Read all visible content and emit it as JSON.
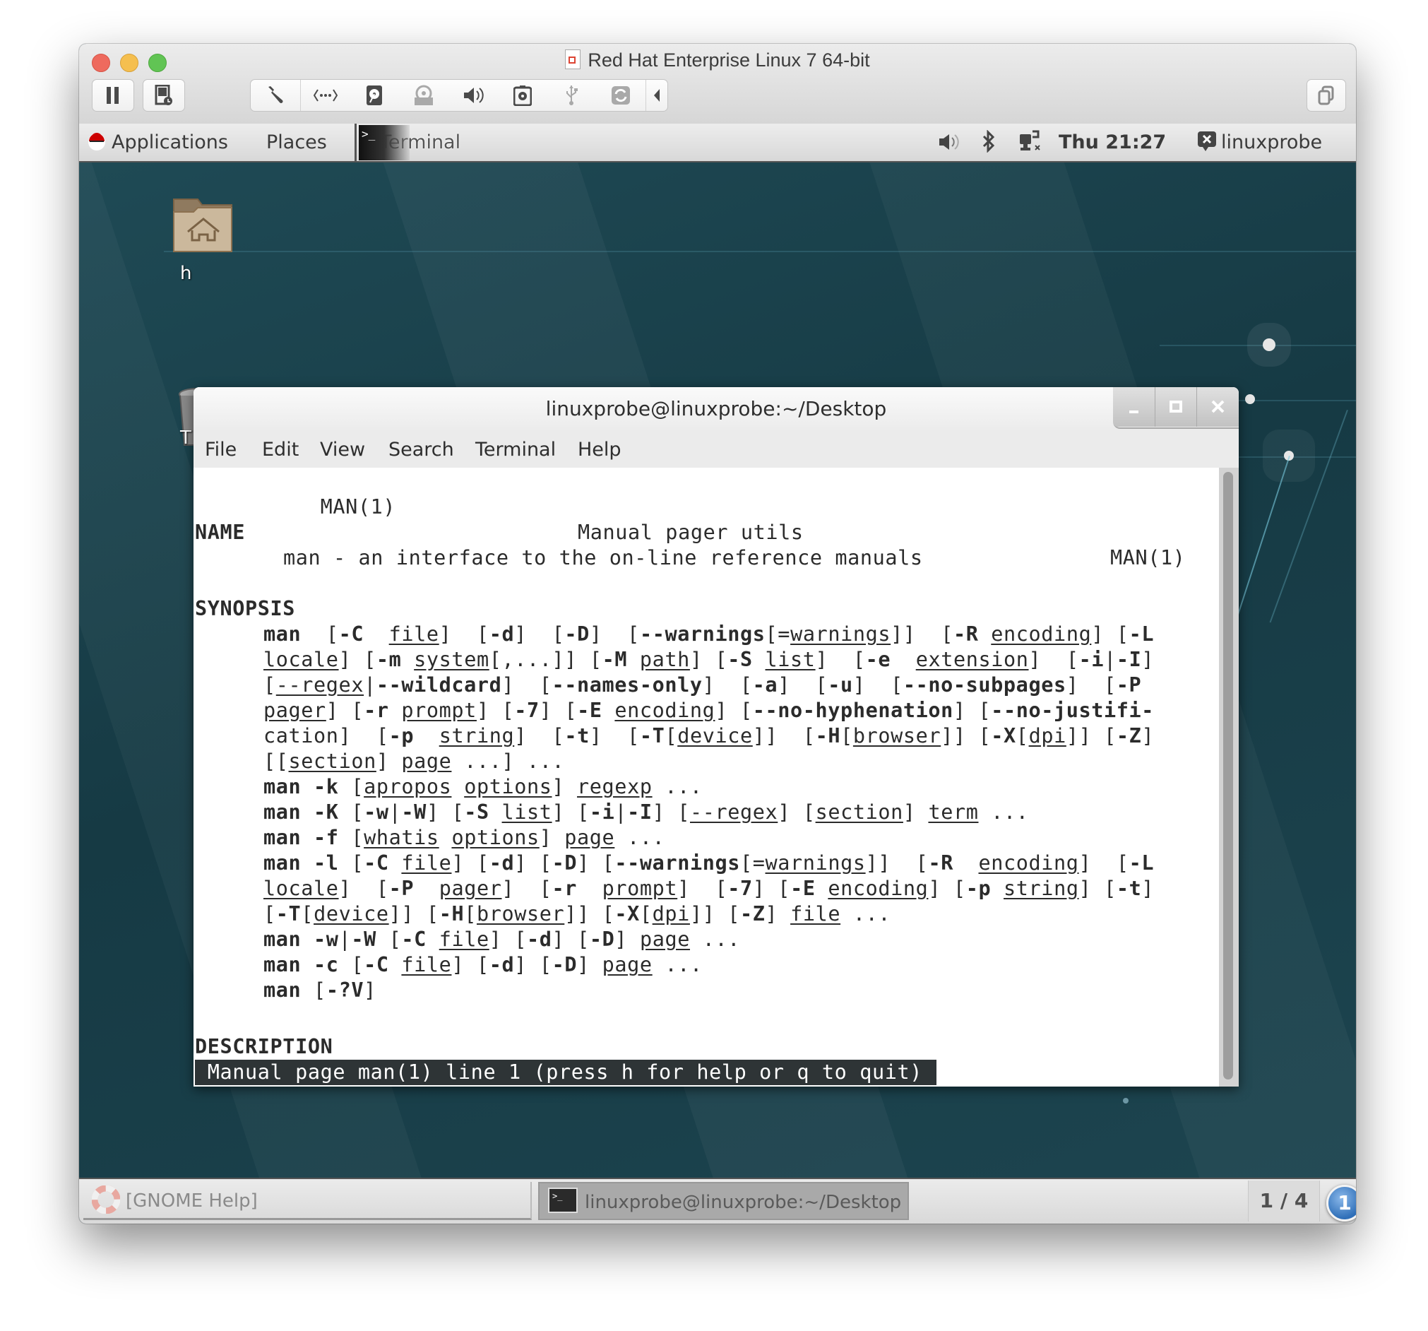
{
  "host_window": {
    "title": "Red Hat Enterprise Linux 7 64-bit",
    "toolbar_icons": [
      "pause-icon",
      "snapshot-icon",
      "settings-wrench-icon",
      "network-icon",
      "hard-disk-icon",
      "cd-dvd-icon",
      "sound-icon",
      "camera-icon",
      "usb-icon",
      "shared-folder-icon",
      "collapse-arrow-icon"
    ],
    "fullscreen_icon": "unity-windows-icon"
  },
  "gnome_top_bar": {
    "applications_label": "Applications",
    "places_label": "Places",
    "active_app_label": "Terminal",
    "clock": "Thu 21:27",
    "user_label": "linuxprobe",
    "status_icons": [
      "volume-icon",
      "bluetooth-icon",
      "network-wired-icon"
    ]
  },
  "desktop": {
    "icons": [
      {
        "label": "h",
        "icon": "home-folder-icon"
      },
      {
        "label": "T",
        "icon": "trash-icon"
      }
    ]
  },
  "terminal": {
    "title": "linuxprobe@linuxprobe:~/Desktop",
    "menu": [
      "File",
      "Edit",
      "View",
      "Search",
      "Terminal",
      "Help"
    ],
    "window_controls": [
      "minimize",
      "maximize",
      "close"
    ],
    "header_left": "MAN(1)",
    "header_center": "Manual pager utils",
    "header_right": "MAN(1)",
    "sections": {
      "name_heading": "NAME",
      "name_text": "man - an interface to the on-line reference manuals",
      "synopsis_heading": "SYNOPSIS",
      "description_heading": "DESCRIPTION"
    },
    "synopsis_lines": [
      "man  [-C  file]  [-d]  [-D]  [--warnings[=warnings]]  [-R encoding] [-L",
      "locale] [-m system[,...]] [-M path] [-S list]  [-e  extension]  [-i|-I]",
      "[--regex|--wildcard]  [--names-only]  [-a]  [-u]  [--no-subpages]  [-P",
      "pager] [-r prompt] [-7] [-E encoding] [--no-hyphenation] [--no-justifi-",
      "cation]  [-p  string]  [-t]  [-T[device]]  [-H[browser]] [-X[dpi]] [-Z]",
      "[[section] page ...] ...",
      "man -k [apropos options] regexp ...",
      "man -K [-w|-W] [-S list] [-i|-I] [--regex] [section] term ...",
      "man -f [whatis options] page ...",
      "man -l [-C file] [-d] [-D] [--warnings[=warnings]]  [-R  encoding]  [-L",
      "locale]  [-P  pager]  [-r  prompt]  [-7] [-E encoding] [-p string] [-t]",
      "[-T[device]] [-H[browser]] [-X[dpi]] [-Z] file ...",
      "man -w|-W [-C file] [-d] [-D] page ...",
      "man -c [-C file] [-d] [-D] page ...",
      "man [-?V]"
    ],
    "status_line": " Manual page man(1) line 1 (press h for help or q to quit)"
  },
  "gnome_bottom_bar": {
    "tasks": [
      {
        "label": "[GNOME Help]",
        "icon": "help-lifebuoy-icon",
        "active": false
      },
      {
        "label": "linuxprobe@linuxprobe:~/Desktop",
        "icon": "terminal-icon",
        "active": true
      }
    ],
    "workspace": "1 / 4",
    "notification_count": "1"
  },
  "colors": {
    "desktop_bg": "#1b3f49",
    "status_bar_bg": "#2e3436",
    "mac_red": "#ee6a5e",
    "mac_yellow": "#f5bf4f",
    "mac_green": "#61c454",
    "badge_blue": "#2f6fb8"
  }
}
